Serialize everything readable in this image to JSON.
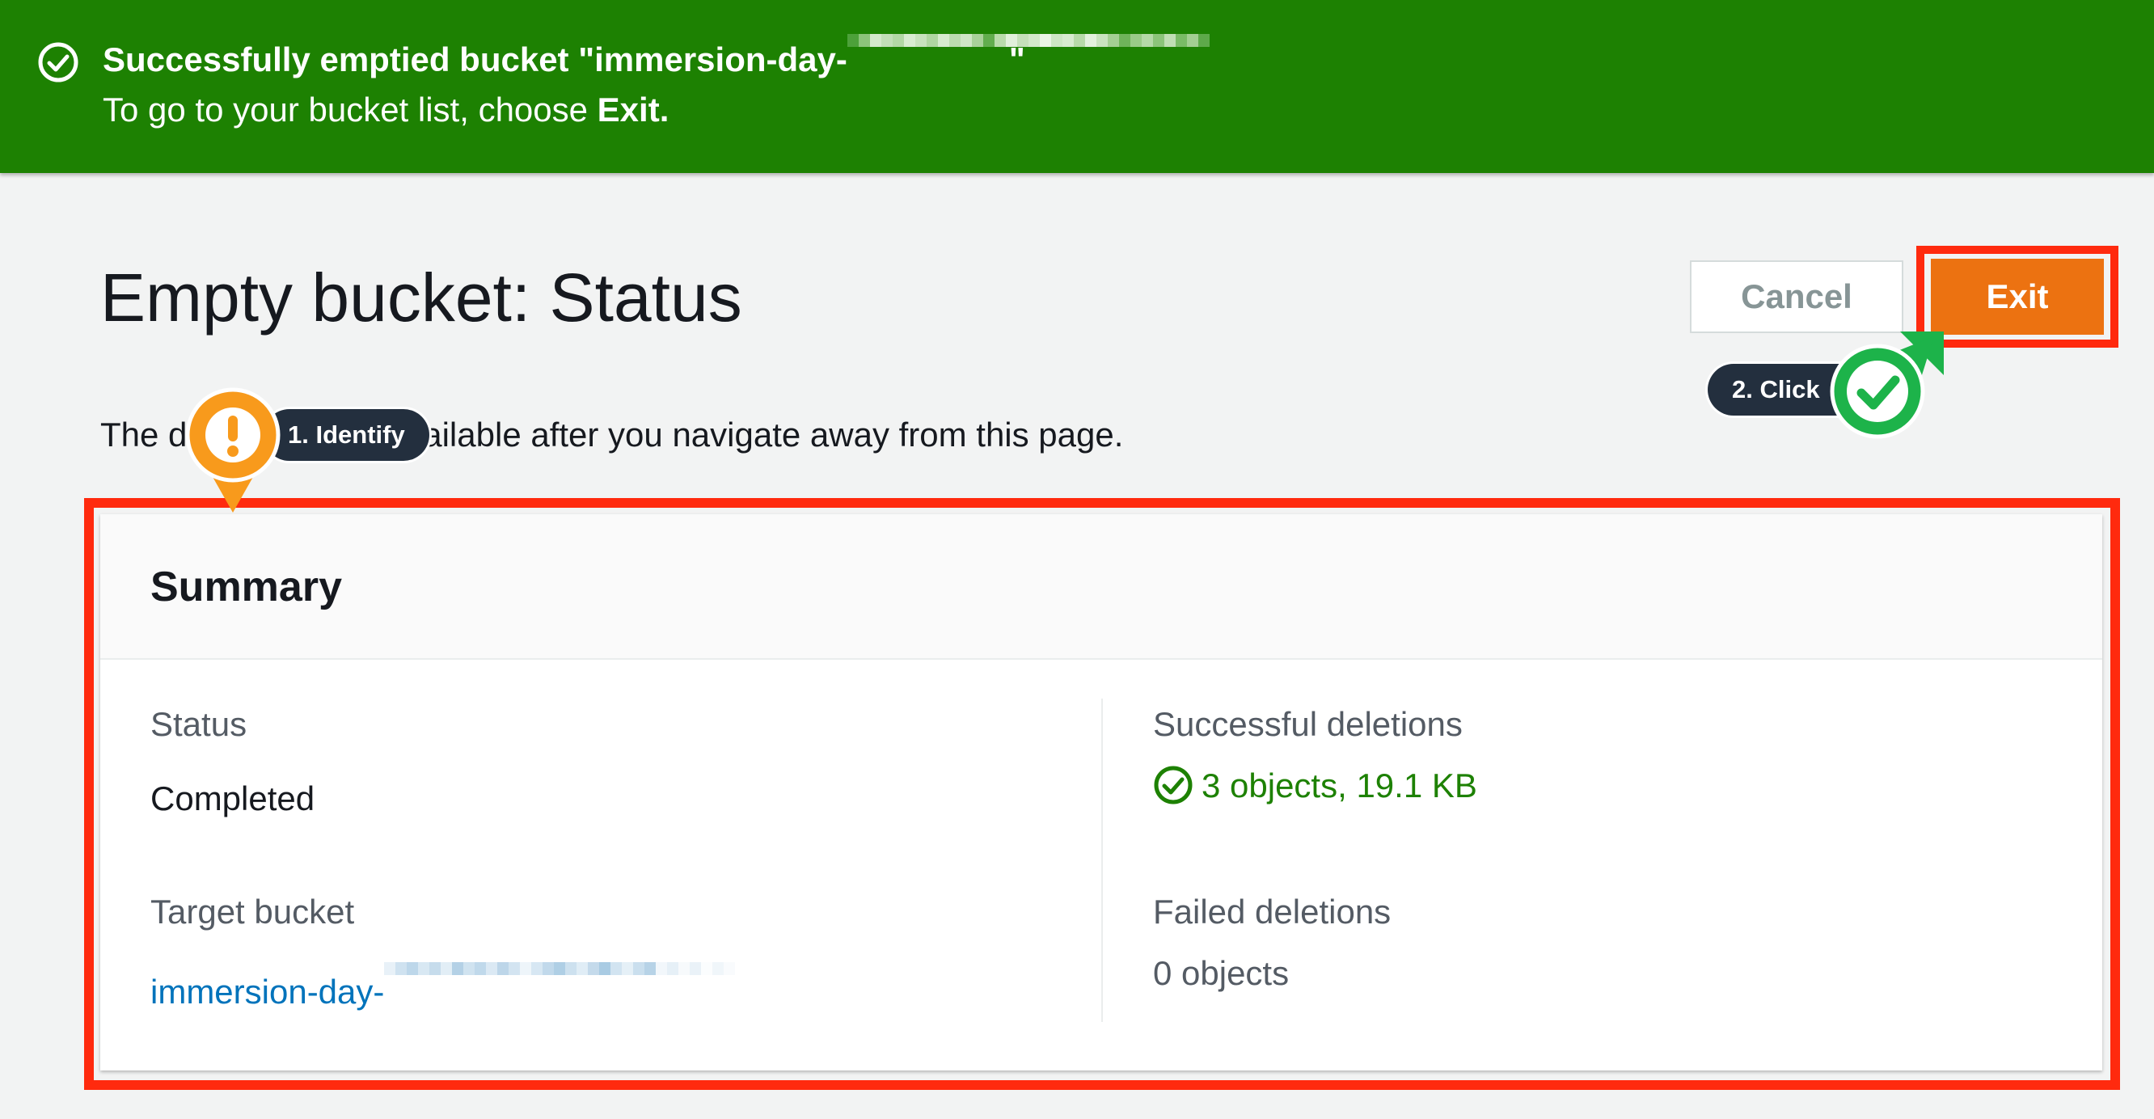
{
  "flash": {
    "title_prefix": "Successfully emptied bucket \"immersion-day-",
    "title_suffix": "\"",
    "message_prefix": "To go to your bucket list, choose ",
    "message_bold": "Exit."
  },
  "header": {
    "title": "Empty bucket: Status",
    "cancel_label": "Cancel",
    "exit_label": "Exit"
  },
  "description": "The d           re no longer available after you navigate away from this page.",
  "summary": {
    "title": "Summary",
    "status_label": "Status",
    "status_value": "Completed",
    "target_bucket_label": "Target bucket",
    "target_bucket_value": "immersion-day-",
    "successful_label": "Successful deletions",
    "successful_value": "3 objects, 19.1 KB",
    "failed_label": "Failed deletions",
    "failed_value": "0 objects"
  },
  "annotations": {
    "step1": "1. Identify",
    "step2": "2. Click"
  },
  "colors": {
    "flash_bg": "#1d8102",
    "primary_button": "#ec7211",
    "highlight": "#ff2a0e",
    "link": "#0073bb",
    "success": "#1d8102",
    "marker_orange": "#f89a1c",
    "marker_green": "#1db34a"
  },
  "icons": {
    "flash": "check-circle-icon",
    "success": "check-circle-icon",
    "step1": "exclamation-marker-icon",
    "step2": "checkmark-marker-icon"
  }
}
